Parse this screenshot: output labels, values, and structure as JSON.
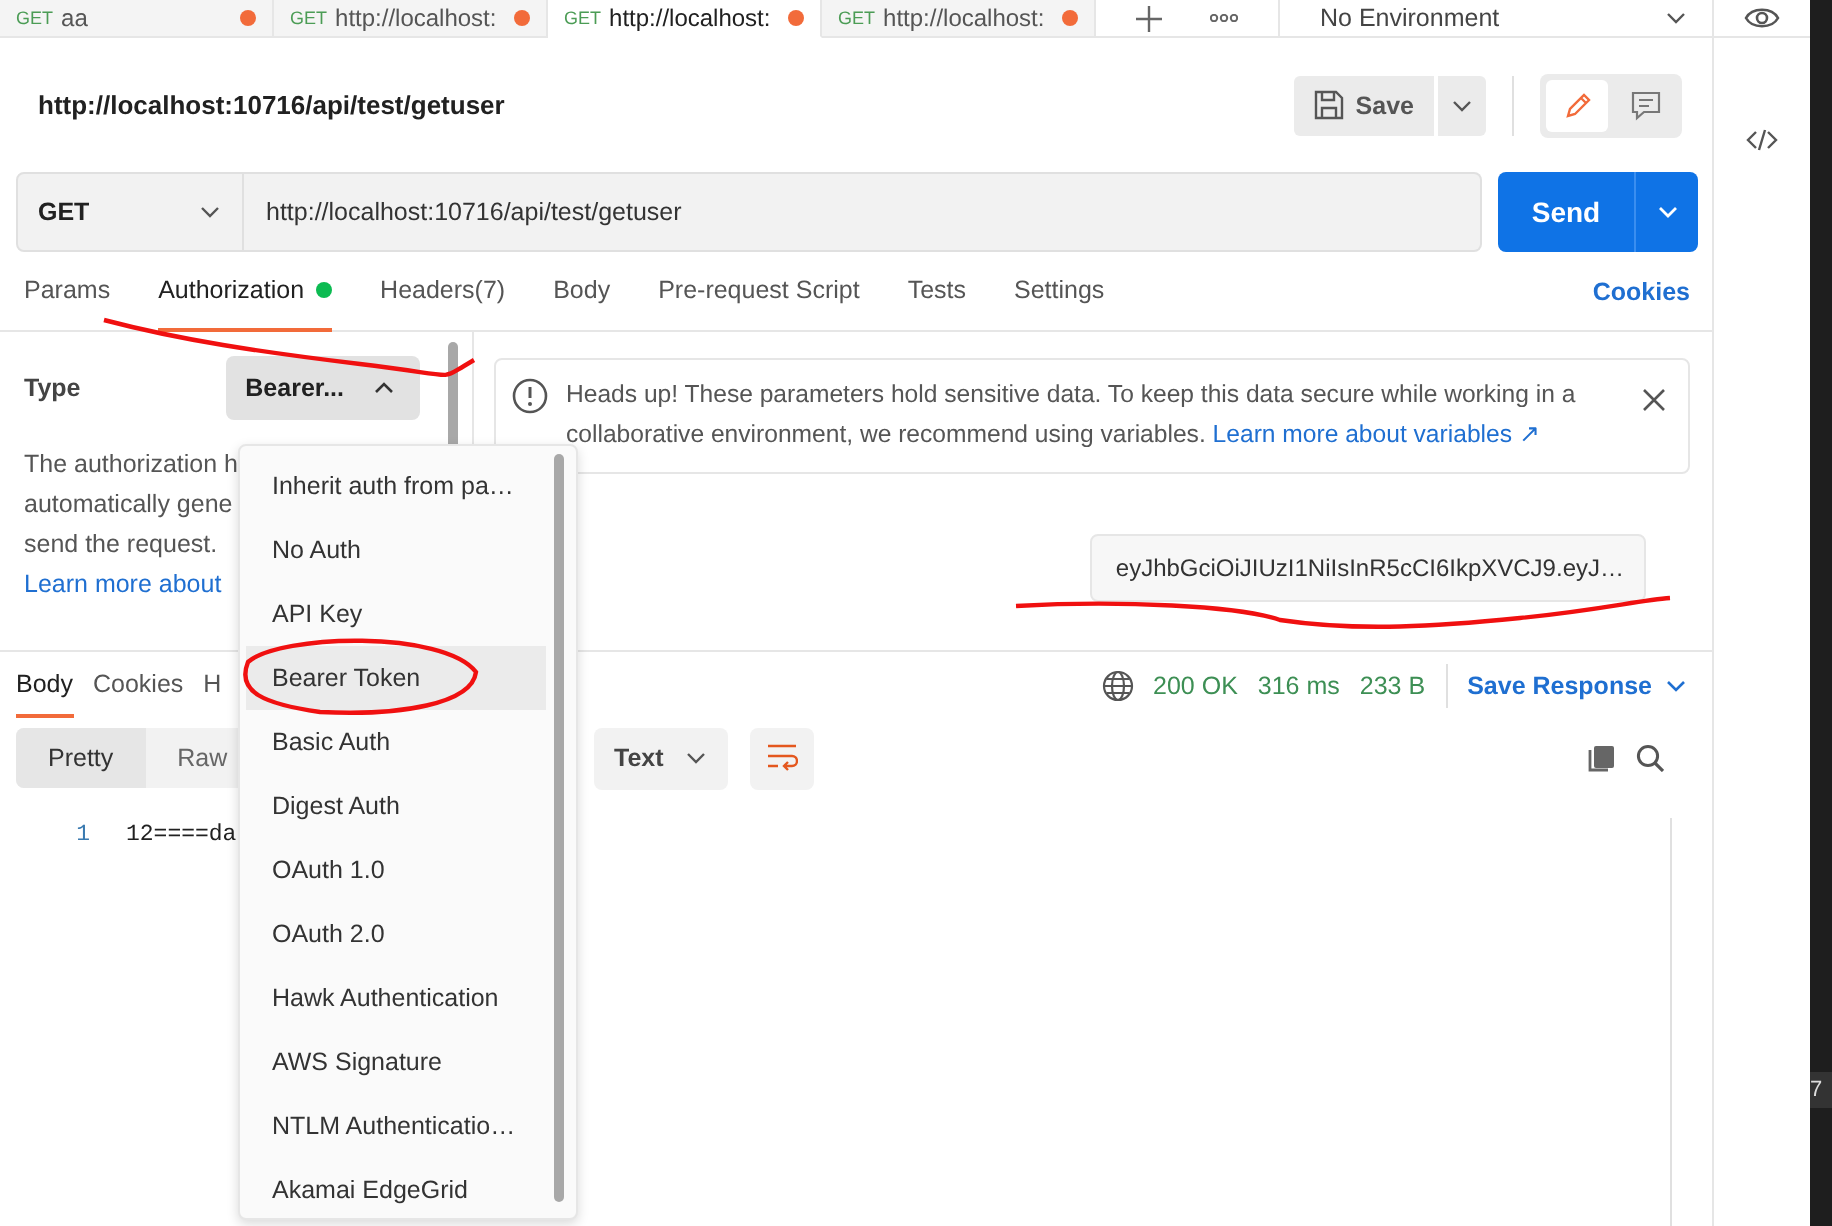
{
  "open_tabs": [
    {
      "method": "GET",
      "title": "aa",
      "unsaved": true,
      "selected": false
    },
    {
      "method": "GET",
      "title": "http://localhost:",
      "unsaved": true,
      "selected": false
    },
    {
      "method": "GET",
      "title": "http://localhost:",
      "unsaved": true,
      "selected": true
    },
    {
      "method": "GET",
      "title": "http://localhost:",
      "unsaved": true,
      "selected": false
    }
  ],
  "environment": {
    "label": "No Environment"
  },
  "request": {
    "title": "http://localhost:10716/api/test/getuser",
    "save": "Save",
    "method": "GET",
    "url": "http://localhost:10716/api/test/getuser",
    "send": "Send"
  },
  "request_tabs": [
    {
      "label": "Params",
      "selected": false,
      "indicator": false
    },
    {
      "label": "Authorization",
      "selected": true,
      "indicator": true
    },
    {
      "label": "Headers",
      "count": "(7)",
      "selected": false,
      "indicator": false
    },
    {
      "label": "Body",
      "selected": false,
      "indicator": false
    },
    {
      "label": "Pre-request Script",
      "selected": false,
      "indicator": false
    },
    {
      "label": "Tests",
      "selected": false,
      "indicator": false
    },
    {
      "label": "Settings",
      "selected": false,
      "indicator": false
    }
  ],
  "cookies_link": "Cookies",
  "auth": {
    "type_label": "Type",
    "type_value": "Bearer...",
    "expanded": true,
    "description_lines": [
      "The authorization h",
      "automatically gene",
      "send the request."
    ],
    "learn_more": "Learn more about",
    "alert": {
      "text": "Heads up! These parameters hold sensitive data. To keep this data secure while working in a collaborative environment, we recommend using variables.",
      "link": "Learn more about variables ↗"
    },
    "token": "eyJhbGciOiJIUzI1NiIsInR5cCI6IkpXVCJ9.eyJ…"
  },
  "auth_menu": {
    "items": [
      {
        "label": "Inherit auth from pa…",
        "selected": false
      },
      {
        "label": "No Auth",
        "selected": false
      },
      {
        "label": "API Key",
        "selected": false
      },
      {
        "label": "Bearer Token",
        "selected": true
      },
      {
        "label": "Basic Auth",
        "selected": false
      },
      {
        "label": "Digest Auth",
        "selected": false
      },
      {
        "label": "OAuth 1.0",
        "selected": false
      },
      {
        "label": "OAuth 2.0",
        "selected": false
      },
      {
        "label": "Hawk Authentication",
        "selected": false
      },
      {
        "label": "AWS Signature",
        "selected": false
      },
      {
        "label": "NTLM Authenticatio…",
        "selected": false
      },
      {
        "label": "Akamai EdgeGrid",
        "selected": false
      }
    ]
  },
  "response": {
    "tabs": [
      {
        "label": "Body",
        "selected": true
      },
      {
        "label": "Cookies",
        "selected": false
      },
      {
        "label": "H",
        "selected": false
      }
    ],
    "status": "200 OK",
    "time": "316 ms",
    "size": "233 B",
    "save": "Save Response",
    "formats": [
      {
        "label": "Pretty",
        "selected": true
      },
      {
        "label": "Raw",
        "selected": false
      }
    ],
    "view_type": "Text",
    "lines": [
      {
        "number": "1",
        "text": "12====da"
      }
    ]
  },
  "side_strip_text": "7"
}
